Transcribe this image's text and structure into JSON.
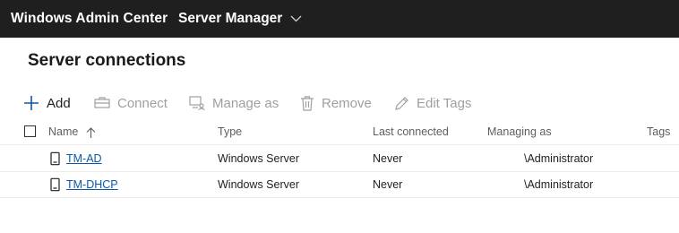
{
  "app": {
    "brand": "Windows Admin Center",
    "tool_name": "Server Manager"
  },
  "page": {
    "title": "Server connections"
  },
  "toolbar": {
    "add": "Add",
    "connect": "Connect",
    "manage_as": "Manage as",
    "remove": "Remove",
    "edit_tags": "Edit Tags"
  },
  "table": {
    "columns": {
      "name": "Name",
      "type": "Type",
      "last_connected": "Last connected",
      "managing_as": "Managing as",
      "tags": "Tags"
    },
    "rows": [
      {
        "name": "TM-AD",
        "type": "Windows Server",
        "last_connected": "Never",
        "managing_as": "\\Administrator",
        "tags": ""
      },
      {
        "name": "TM-DHCP",
        "type": "Windows Server",
        "last_connected": "Never",
        "managing_as": "\\Administrator",
        "tags": ""
      }
    ]
  },
  "colors": {
    "topbar": "#1f1f1f",
    "link": "#0b57a6",
    "disabled": "#a19f9d"
  },
  "icons": {
    "add": "plus-icon",
    "connect": "connect-icon",
    "manage_as": "manage-as-icon",
    "remove": "trash-icon",
    "edit_tags": "pencil-icon",
    "row": "server-icon",
    "sort": "sort-ascending-icon",
    "tool_switch": "chevron-down-icon"
  }
}
